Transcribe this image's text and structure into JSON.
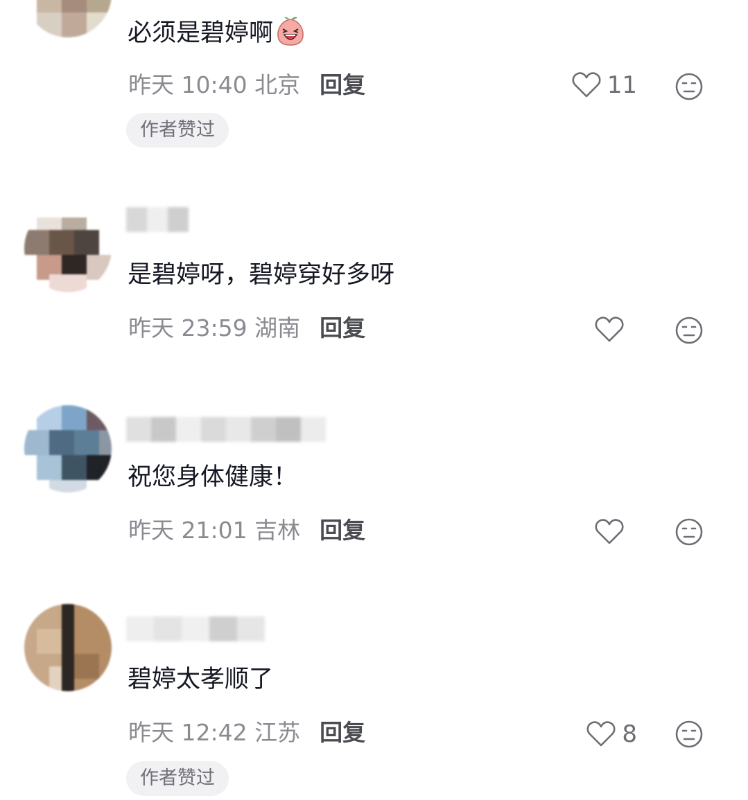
{
  "comments": [
    {
      "text": "必须是碧婷啊",
      "time": "昨天 10:40 北京",
      "reply_label": "回复",
      "likes": "11",
      "badge": "作者赞过",
      "emoji": "laughing-peach-emoji"
    },
    {
      "text": "是碧婷呀，碧婷穿好多呀",
      "time": "昨天 23:59 湖南",
      "reply_label": "回复",
      "likes": ""
    },
    {
      "text": "祝您身体健康！",
      "time": "昨天 21:01 吉林",
      "reply_label": "回复",
      "likes": ""
    },
    {
      "text": "碧婷太孝顺了",
      "time": "昨天 12:42 江苏",
      "reply_label": "回复",
      "likes": "8",
      "badge": "作者赞过"
    }
  ],
  "icons": {
    "like": "heart-outline-icon",
    "dislike": "meh-face-icon"
  },
  "colors": {
    "text": "#161823",
    "meta": "#8a8b91",
    "badge_bg": "#f1f1f3"
  }
}
